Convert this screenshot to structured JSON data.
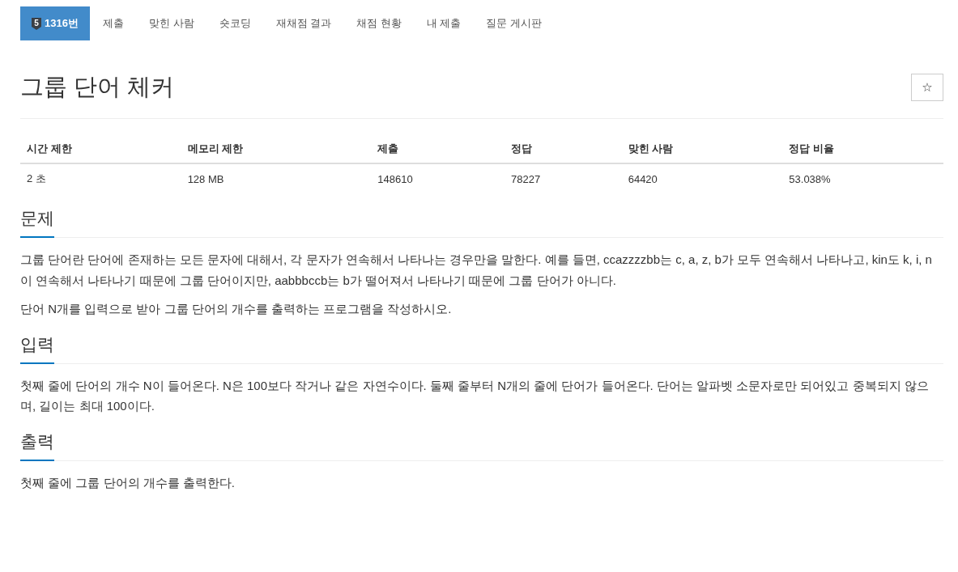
{
  "tabs": [
    {
      "label": "1316번",
      "tier": "5",
      "selected": true
    },
    {
      "label": "제출",
      "selected": false
    },
    {
      "label": "맞힌 사람",
      "selected": false
    },
    {
      "label": "숏코딩",
      "selected": false
    },
    {
      "label": "재채점 결과",
      "selected": false
    },
    {
      "label": "채점 현황",
      "selected": false
    },
    {
      "label": "내 제출",
      "selected": false
    },
    {
      "label": "질문 게시판",
      "selected": false
    }
  ],
  "title": "그룹 단어 체커",
  "star_button": "☆",
  "stats": {
    "columns": [
      "시간 제한",
      "메모리 제한",
      "제출",
      "정답",
      "맞힌 사람",
      "정답 비율"
    ],
    "values": [
      "2 초",
      "128 MB",
      "148610",
      "78227",
      "64420",
      "53.038%"
    ]
  },
  "sections": [
    {
      "heading": "문제",
      "paragraphs": [
        "그룹 단어란 단어에 존재하는 모든 문자에 대해서, 각 문자가 연속해서 나타나는 경우만을 말한다. 예를 들면, ccazzzzbb는 c, a, z, b가 모두 연속해서 나타나고, kin도 k, i, n이 연속해서 나타나기 때문에 그룹 단어이지만, aabbbccb는 b가 떨어져서 나타나기 때문에 그룹 단어가 아니다.",
        "단어 N개를 입력으로 받아 그룹 단어의 개수를 출력하는 프로그램을 작성하시오."
      ]
    },
    {
      "heading": "입력",
      "paragraphs": [
        "첫째 줄에 단어의 개수 N이 들어온다. N은 100보다 작거나 같은 자연수이다. 둘째 줄부터 N개의 줄에 단어가 들어온다. 단어는 알파벳 소문자로만 되어있고 중복되지 않으며, 길이는 최대 100이다."
      ]
    },
    {
      "heading": "출력",
      "paragraphs": [
        "첫째 줄에 그룹 단어의 개수를 출력한다."
      ]
    }
  ]
}
